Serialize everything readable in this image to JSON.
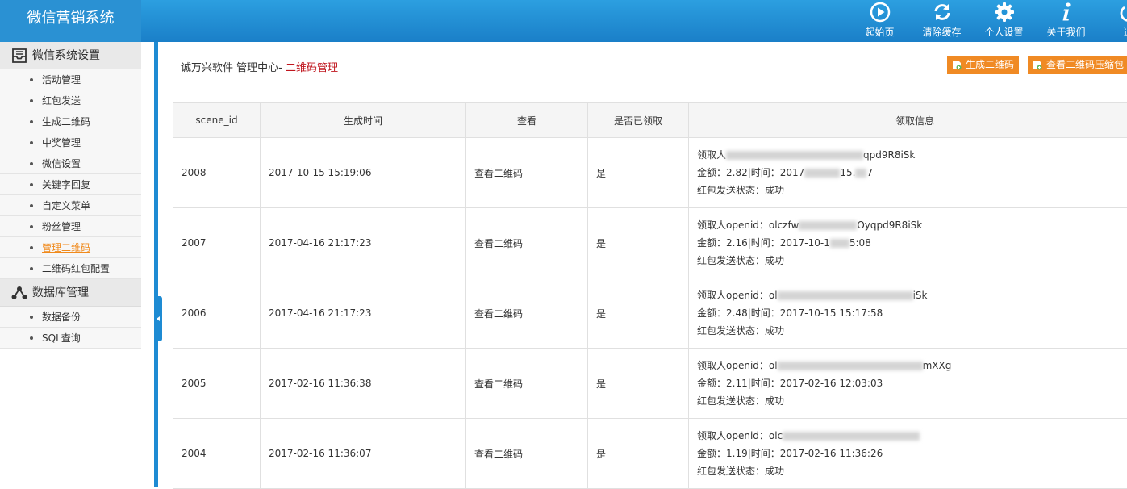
{
  "app": {
    "title": "微信营销系统"
  },
  "toolbar": [
    {
      "label": "起始页",
      "icon": "play-circle-icon"
    },
    {
      "label": "清除缓存",
      "icon": "refresh-icon"
    },
    {
      "label": "个人设置",
      "icon": "gear-icon"
    },
    {
      "label": "关于我们",
      "icon": "info-icon"
    },
    {
      "label": "退",
      "icon": "power-icon"
    }
  ],
  "sidebar": {
    "groups": [
      {
        "label": "微信系统设置",
        "icon": "inbox-icon",
        "items": [
          "活动管理",
          "红包发送",
          "生成二维码",
          "中奖管理",
          "微信设置",
          "关键字回复",
          "自定义菜单",
          "粉丝管理",
          "管理二维码",
          "二维码红包配置"
        ]
      },
      {
        "label": "数据库管理",
        "icon": "network-icon",
        "items": [
          "数据备份",
          "SQL查询"
        ]
      }
    ],
    "active_item": "管理二维码"
  },
  "breadcrumb": {
    "prefix": "诚万兴软件 管理中心- ",
    "current": "二维码管理"
  },
  "actions": {
    "generate": "生成二维码",
    "view_zip": "查看二维码压缩包"
  },
  "table": {
    "headers": [
      "scene_id",
      "生成时间",
      "查看",
      "是否已领取",
      "领取信息"
    ],
    "rows": [
      {
        "id": "2008",
        "time": "2017-10-15 15:19:06",
        "view": "查看二维码",
        "claimed": "是",
        "l1a": "领取人",
        "l1b": "qpd9R8iSk",
        "l2a": "金额：2.82|时间：2017",
        "l2b": "15.",
        "l2c": "7",
        "l3": "红包发送状态：成功"
      },
      {
        "id": "2007",
        "time": "2017-04-16 21:17:23",
        "view": "查看二维码",
        "claimed": "是",
        "l1a": "领取人openid：olczfw",
        "l1b": "Oyqpd9R8iSk",
        "l2a": "金额：2.16|时间：2017-10-1",
        "l2b": "5:08",
        "l2c": "",
        "l3": "红包发送状态：成功"
      },
      {
        "id": "2006",
        "time": "2017-04-16 21:17:23",
        "view": "查看二维码",
        "claimed": "是",
        "l1a": "领取人openid：ol",
        "l1b": "iSk",
        "l2a": "金额：2.48|时间：2017-10-15 15:17:58",
        "l2b": "",
        "l2c": "",
        "l3": "红包发送状态：成功"
      },
      {
        "id": "2005",
        "time": "2017-02-16 11:36:38",
        "view": "查看二维码",
        "claimed": "是",
        "l1a": "领取人openid：ol",
        "l1b": "mXXg",
        "l2a": "金额：2.11|时间：2017-02-16 12:03:03",
        "l2b": "",
        "l2c": "",
        "l3": "红包发送状态：成功"
      },
      {
        "id": "2004",
        "time": "2017-02-16 11:36:07",
        "view": "查看二维码",
        "claimed": "是",
        "l1a": "领取人openid：olc",
        "l1b": "",
        "l2a": "金额：1.19|时间：2017-02-16 11:36:26",
        "l2b": "",
        "l2c": "",
        "l3": "红包发送状态：成功"
      }
    ]
  },
  "colors": {
    "header_blue": "#1e8bd3",
    "accent_orange": "#f08a24",
    "breadcrumb_red": "#c0161e",
    "active_link": "#f08a1c"
  }
}
